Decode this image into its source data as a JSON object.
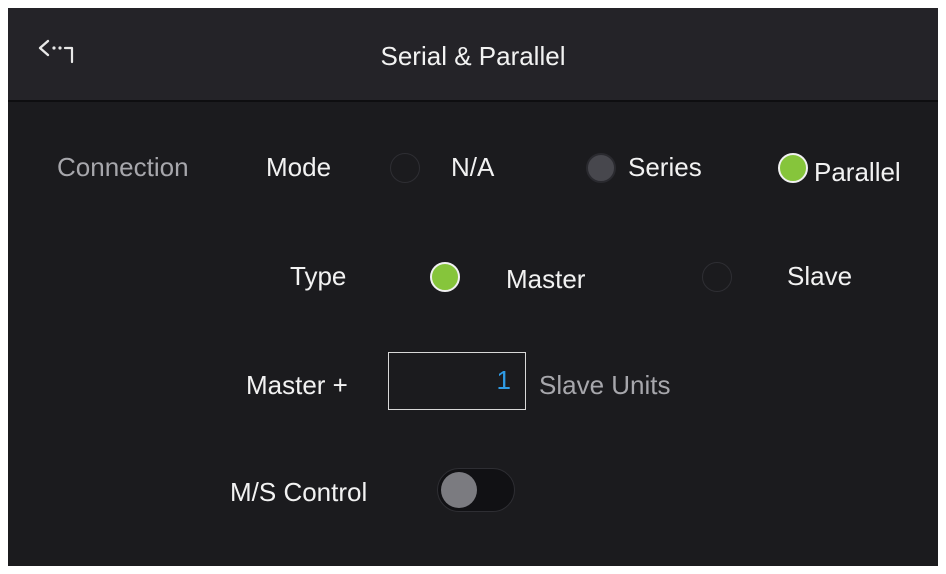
{
  "header": {
    "title": "Serial & Parallel",
    "back_icon": "back-arrow-icon"
  },
  "connection": {
    "section_label": "Connection",
    "mode": {
      "label": "Mode",
      "options": [
        "N/A",
        "Series",
        "Parallel"
      ],
      "selected": "Parallel"
    },
    "type": {
      "label": "Type",
      "options": [
        "Master",
        "Slave"
      ],
      "selected": "Master"
    },
    "units": {
      "prefix": "Master +",
      "value": "1",
      "suffix": "Slave Units"
    },
    "ms_control": {
      "label": "M/S Control",
      "enabled": false
    }
  },
  "colors": {
    "selected": "#86c53b",
    "value_text": "#2f9be5",
    "background": "#1b1b1e",
    "titlebar": "#242328"
  }
}
